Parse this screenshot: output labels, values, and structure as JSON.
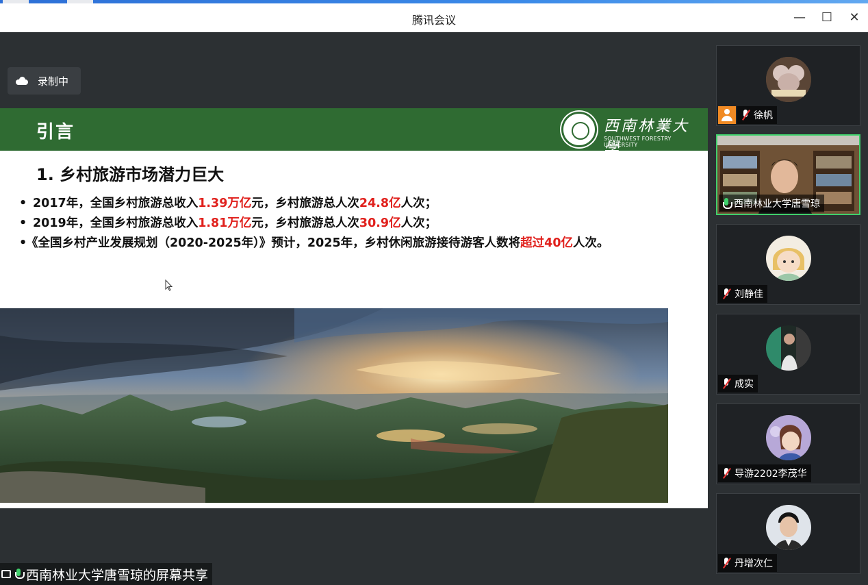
{
  "window": {
    "title": "腾讯会议",
    "minimize_glyph": "—",
    "maximize_glyph": "☐",
    "close_glyph": "✕"
  },
  "recording": {
    "label": "录制中",
    "icon": "cloud-icon"
  },
  "slide": {
    "header_title": "引言",
    "logo_cn": "西南林業大學",
    "logo_en": "SOUTHWEST FORESTRY UNIVERSITY",
    "heading": "1. 乡村旅游市场潜力巨大",
    "bullets": [
      {
        "dot": "•",
        "parts": [
          {
            "t": "2017年，全国乡村旅游总收入",
            "red": false
          },
          {
            "t": "1.39万亿",
            "red": true
          },
          {
            "t": "元，乡村旅游总人次",
            "red": false
          },
          {
            "t": "24.8亿",
            "red": true
          },
          {
            "t": "人次；",
            "red": false
          }
        ]
      },
      {
        "dot": "•",
        "parts": [
          {
            "t": "2019年，全国乡村旅游总收入",
            "red": false
          },
          {
            "t": "1.81万亿",
            "red": true
          },
          {
            "t": "元，乡村旅游总人次",
            "red": false
          },
          {
            "t": "30.9亿",
            "red": true
          },
          {
            "t": "人次；",
            "red": false
          }
        ]
      },
      {
        "dot": "•",
        "parts": [
          {
            "t": "《全国乡村产业发展规划（2020-2025年）》预计，2025年，乡村休闲旅游接待游客人数将",
            "red": false
          },
          {
            "t": "超过40亿",
            "red": true
          },
          {
            "t": "人次。",
            "red": false
          }
        ]
      }
    ]
  },
  "share_label": "西南林业大学唐雪琼的屏幕共享",
  "participants": [
    {
      "name": "徐帆",
      "host": true,
      "mic": "muted",
      "avatar": "cartoon"
    },
    {
      "name": "西南林业大学唐雪琼",
      "host": false,
      "mic": "live",
      "avatar": "video"
    },
    {
      "name": "刘静佳",
      "host": false,
      "mic": "muted",
      "avatar": "girl"
    },
    {
      "name": "成实",
      "host": false,
      "mic": "muted",
      "avatar": "photo"
    },
    {
      "name": "导游2202李茂华",
      "host": false,
      "mic": "muted",
      "avatar": "purple"
    },
    {
      "name": "丹增次仁",
      "host": false,
      "mic": "muted",
      "avatar": "boy"
    }
  ],
  "colors": {
    "accent_green": "#2f6b32",
    "highlight_red": "#e0201c",
    "speaking_green": "#3fd06b"
  }
}
